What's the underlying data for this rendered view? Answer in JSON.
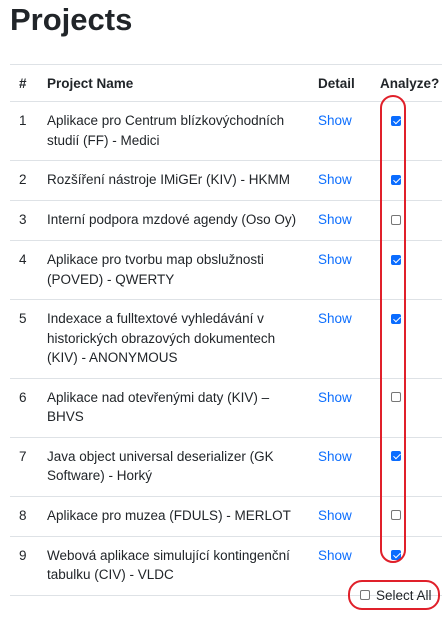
{
  "page": {
    "title": "Projects"
  },
  "table": {
    "headers": {
      "num": "#",
      "name": "Project Name",
      "detail": "Detail",
      "analyze": "Analyze?"
    },
    "rows": [
      {
        "num": "1",
        "name": "Aplikace pro Centrum blízkovýchodních studií (FF) - Medici",
        "detail": "Show",
        "analyze": true
      },
      {
        "num": "2",
        "name": "Rozšíření nástroje IMiGEr (KIV) - HKMM",
        "detail": "Show",
        "analyze": true
      },
      {
        "num": "3",
        "name": "Interní podpora mzdové agendy (Oso Oy)",
        "detail": "Show",
        "analyze": false
      },
      {
        "num": "4",
        "name": "Aplikace pro tvorbu map obslužnosti (POVED) - QWERTY",
        "detail": "Show",
        "analyze": true
      },
      {
        "num": "5",
        "name": "Indexace a fulltextové vyhledávání v historických obrazových dokumentech (KIV) - ANONYMOUS",
        "detail": "Show",
        "analyze": true
      },
      {
        "num": "6",
        "name": "Aplikace nad otevřenými daty (KIV) – BHVS",
        "detail": "Show",
        "analyze": false
      },
      {
        "num": "7",
        "name": "Java object universal deserializer (GK Software) - Horký",
        "detail": "Show",
        "analyze": true
      },
      {
        "num": "8",
        "name": "Aplikace pro muzea (FDULS) - MERLOT",
        "detail": "Show",
        "analyze": false
      },
      {
        "num": "9",
        "name": "Webová aplikace simulující kontingenční tabulku (CIV) - VLDC",
        "detail": "Show",
        "analyze": true
      }
    ]
  },
  "select_all": {
    "label": "Select All",
    "checked": false
  },
  "colors": {
    "link": "#0d6efd",
    "checkbox_checked": "#0a6cff",
    "highlight": "#e0202a"
  }
}
